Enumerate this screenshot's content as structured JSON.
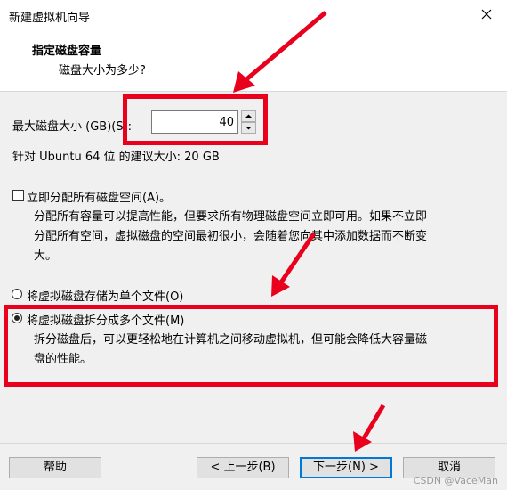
{
  "window": {
    "title": "新建虚拟机向导"
  },
  "header": {
    "title": "指定磁盘容量",
    "subtitle": "磁盘大小为多少?"
  },
  "disk": {
    "size_label": "最大磁盘大小 (GB)(S):",
    "size_value": "40",
    "recommend_text": "针对 Ubuntu 64 位 的建议大小: 20 GB"
  },
  "allocate": {
    "checkbox_label": "立即分配所有磁盘空间(A)。",
    "checked": false,
    "desc_line1": "分配所有容量可以提高性能，但要求所有物理磁盘空间立即可用。如果不立即",
    "desc_line2": "分配所有空间，虚拟磁盘的空间最初很小，会随着您向其中添加数据而不断变",
    "desc_line3": "大。"
  },
  "storage": {
    "single_label": "将虚拟磁盘存储为单个文件(O)",
    "split_label": "将虚拟磁盘拆分成多个文件(M)",
    "selected": "split",
    "split_desc_line1": "拆分磁盘后，可以更轻松地在计算机之间移动虚拟机，但可能会降低大容量磁",
    "split_desc_line2": "盘的性能。"
  },
  "buttons": {
    "help": "帮助",
    "back": "< 上一步(B)",
    "next": "下一步(N) >",
    "cancel": "取消"
  },
  "watermark": "CSDN @VaceMan",
  "colors": {
    "annotation_red": "#e8001c",
    "focus_blue": "#0078d7"
  }
}
